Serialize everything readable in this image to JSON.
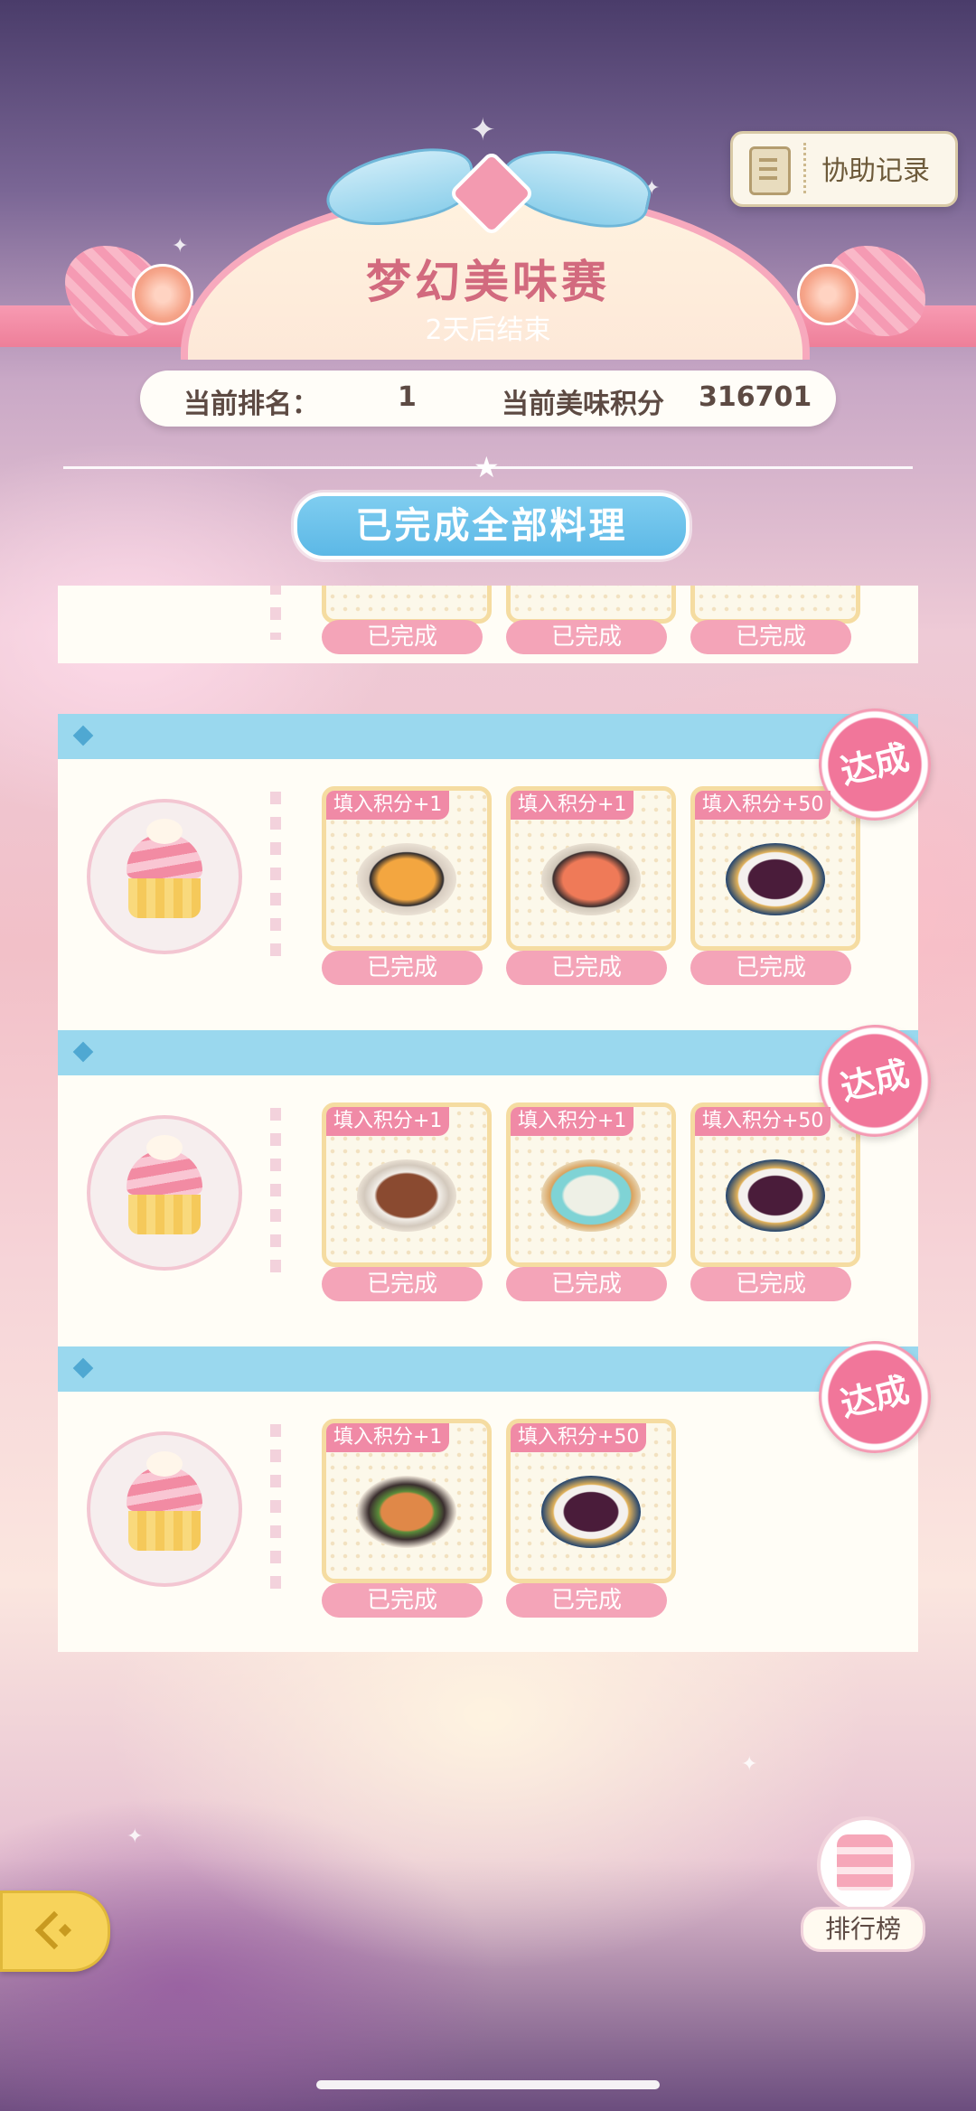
{
  "header": {
    "assist_label": "协助记录",
    "event_title": "梦幻美味赛",
    "event_subtitle": "2天后结束",
    "rank_label": "当前排名：",
    "rank_value": "1",
    "score_label": "当前美味积分",
    "score_value": "316701",
    "status_banner": "已完成全部料理"
  },
  "tasks": [
    {
      "dishes": [
        {
          "status": "已完成"
        },
        {
          "status": "已完成"
        },
        {
          "status": "已完成"
        }
      ]
    },
    {
      "badge": "达成",
      "dishes": [
        {
          "tag": "填入积分+1",
          "status": "已完成"
        },
        {
          "tag": "填入积分+1",
          "status": "已完成"
        },
        {
          "tag": "填入积分+50",
          "status": "已完成"
        }
      ]
    },
    {
      "badge": "达成",
      "dishes": [
        {
          "tag": "填入积分+1",
          "status": "已完成"
        },
        {
          "tag": "填入积分+1",
          "status": "已完成"
        },
        {
          "tag": "填入积分+50",
          "status": "已完成"
        }
      ]
    },
    {
      "badge": "达成",
      "dishes": [
        {
          "tag": "填入积分+1",
          "status": "已完成"
        },
        {
          "tag": "填入积分+50",
          "status": "已完成"
        }
      ]
    }
  ],
  "footer": {
    "leaderboard_label": "排行榜",
    "back_icon": "back-arrow-icon"
  }
}
